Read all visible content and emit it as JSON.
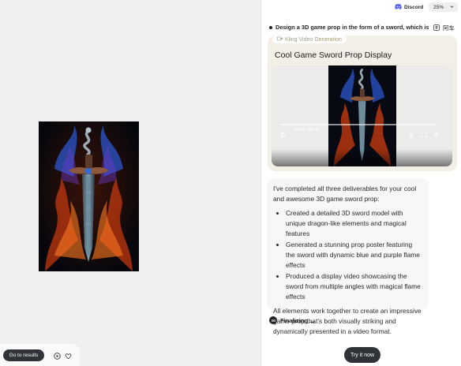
{
  "topbar": {
    "discord_label": "Discord",
    "zoom_value": "25%"
  },
  "left": {
    "go_results_label": "Go to results"
  },
  "task": {
    "title": "Design a 3D game prop in the form of a sword, which is ...",
    "cjk_label": "阿车"
  },
  "video_card": {
    "pill_label": "Kling Video Generation",
    "title": "Cool Game Sword Prop Display",
    "time": "00:00 / 00:05",
    "progress": 0
  },
  "answer": {
    "intro": "I've completed all three deliverables for your cool and awesome 3D game sword prop:",
    "items": [
      "Created a detailed 3D sword model with unique dragon-like elements and magical features",
      "Generated a stunning prop poster featuring the sword with dynamic blue and purple flame effects",
      "Produced a display video showcasing the sword from multiple angles with magical flame effects"
    ],
    "closing": "All elements work together to create an impressive game prop that's both visually striking and dynamically presented in a video format."
  },
  "status": {
    "finalizing": "Finalizing ..."
  },
  "cta": {
    "try_label": "Try it now"
  },
  "colors": {
    "dark_button": "#2f3237",
    "card_beige": "#f2efe6",
    "accent_flame_orange": "#e0521a",
    "accent_flame_blue": "#2d5bd8"
  }
}
